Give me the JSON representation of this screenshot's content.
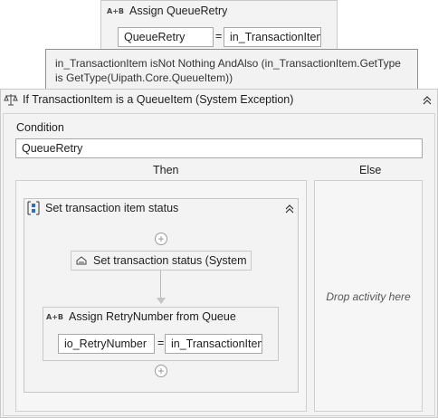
{
  "assign_query_retry": {
    "title": "Assign QueueRetry",
    "icon": "A+B",
    "to_value": "QueueRetry",
    "equals": "=",
    "from_value": "in_TransactionItem"
  },
  "tooltip": {
    "text": "in_TransactionItem isNot Nothing AndAlso (in_TransactionItem.GetType is GetType(Uipath.Core.QueueItem))"
  },
  "if_activity": {
    "title": "If TransactionItem is a QueueItem (System Exception)",
    "condition_label": "Condition",
    "condition_value": "QueueRetry",
    "then_label": "Then",
    "else_label": "Else",
    "else_placeholder": "Drop activity here"
  },
  "sequence": {
    "title": "Set transaction item status",
    "set_status_title": "Set transaction status (System Exception)",
    "assign_title": "Assign RetryNumber from Queue",
    "assign_icon": "A+B",
    "assign_to": "io_RetryNumber",
    "assign_equals": "=",
    "assign_from": "in_TransactionItem"
  },
  "colors": {
    "canvas": "#ffffff",
    "activity_bg": "#f3f3f3",
    "activity_border": "#c9c9c9",
    "tooltip_bg": "#f2f2f2"
  }
}
